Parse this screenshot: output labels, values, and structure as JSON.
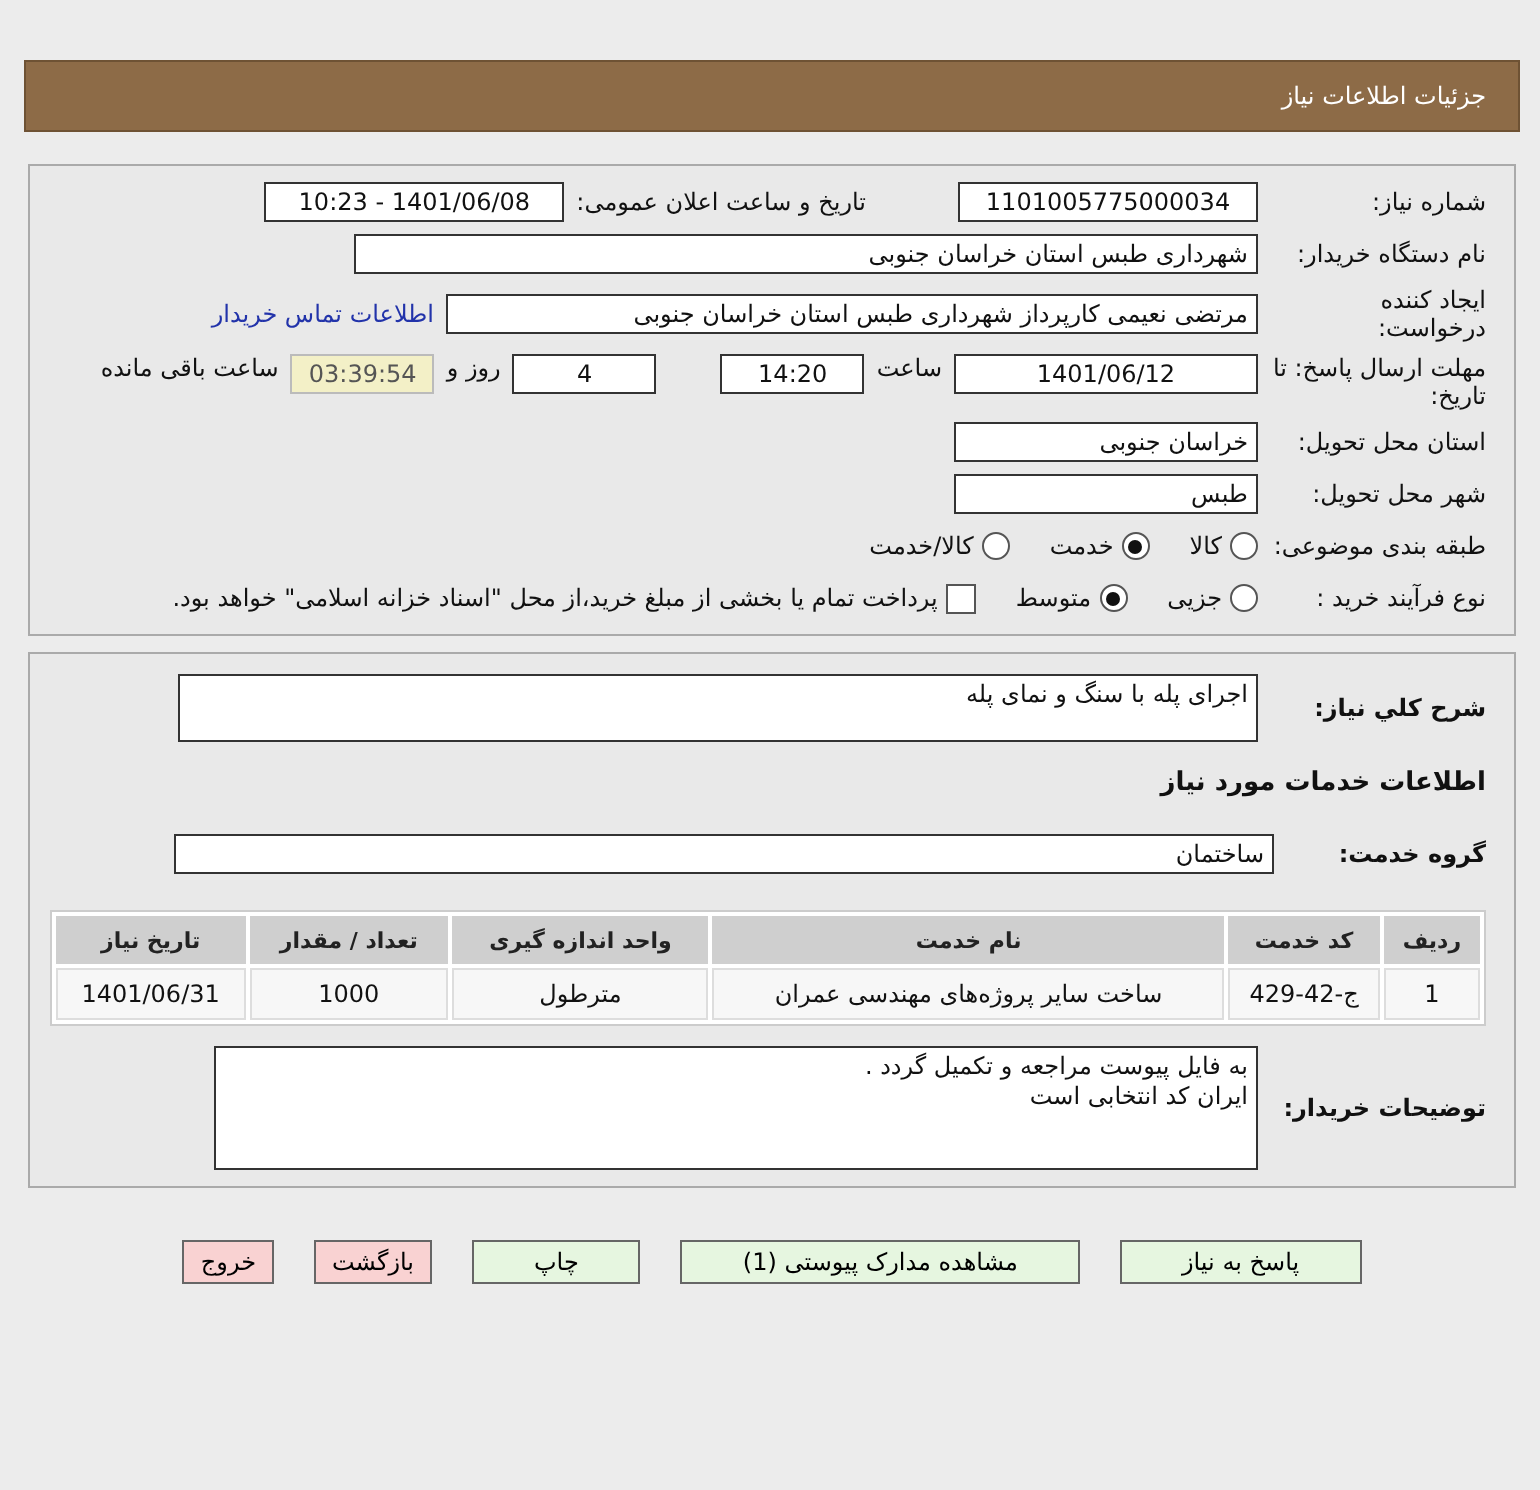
{
  "header": {
    "title": "جزئیات اطلاعات نیاز"
  },
  "details": {
    "need_number": {
      "label": "شماره نیاز:",
      "value": "1101005775000034"
    },
    "announce": {
      "label": "تاریخ و ساعت اعلان عمومی:",
      "value": "1401/06/08 - 10:23"
    },
    "buyer_org": {
      "label": "نام دستگاه خریدار:",
      "value": "شهرداری طبس استان خراسان جنوبی"
    },
    "creator": {
      "label": "ایجاد کننده درخواست:",
      "value": "مرتضی نعیمی کارپرداز شهرداری طبس استان خراسان جنوبی",
      "link": "اطلاعات تماس خریدار"
    },
    "deadline": {
      "label": "مهلت ارسال پاسخ: تا تاریخ:",
      "date": "1401/06/12",
      "time_label": "ساعت",
      "time": "14:20",
      "days": "4",
      "days_label": "روز و",
      "remaining": "03:39:54",
      "remaining_label": "ساعت باقی مانده"
    },
    "province": {
      "label": "استان محل تحویل:",
      "value": "خراسان جنوبی"
    },
    "city": {
      "label": "شهر محل تحویل:",
      "value": "طبس"
    },
    "category": {
      "label": "طبقه بندی موضوعی:",
      "options": [
        {
          "label": "کالا",
          "selected": false
        },
        {
          "label": "خدمت",
          "selected": true
        },
        {
          "label": "کالا/خدمت",
          "selected": false
        }
      ]
    },
    "process": {
      "label": "نوع فرآیند خرید :",
      "options": [
        {
          "label": "جزیی",
          "selected": false
        },
        {
          "label": "متوسط",
          "selected": true
        }
      ],
      "payment": {
        "checked": false,
        "label": "پرداخت تمام یا بخشی از مبلغ خرید،از محل \"اسناد خزانه اسلامی\" خواهد بود."
      }
    }
  },
  "summary": {
    "description": {
      "label": "شرح کلي نیاز:",
      "value": "اجرای پله با سنگ و نمای پله"
    },
    "services_title": "اطلاعات خدمات مورد نیاز",
    "service_group": {
      "label": "گروه خدمت:",
      "value": "ساختمان"
    },
    "table": {
      "columns": [
        "ردیف",
        "کد خدمت",
        "نام خدمت",
        "واحد اندازه گیری",
        "تعداد / مقدار",
        "تاریخ نیاز"
      ],
      "rows": [
        [
          "1",
          "ج-42-429",
          "ساخت سایر پروژه‌های مهندسی عمران",
          "مترطول",
          "1000",
          "1401/06/31"
        ]
      ]
    },
    "buyer_notes": {
      "label": "توضیحات خریدار:",
      "lines": [
        "به فایل پیوست مراجعه و تکمیل گردد .",
        "ایران کد انتخابی است"
      ]
    }
  },
  "buttons": [
    {
      "label": "پاسخ به نیاز",
      "kind": "action"
    },
    {
      "label": "مشاهده مدارک پیوستی (1)",
      "kind": "action"
    },
    {
      "label": "چاپ",
      "kind": "action"
    },
    {
      "label": "بازگشت",
      "kind": "danger"
    },
    {
      "label": "خروج",
      "kind": "danger"
    }
  ]
}
